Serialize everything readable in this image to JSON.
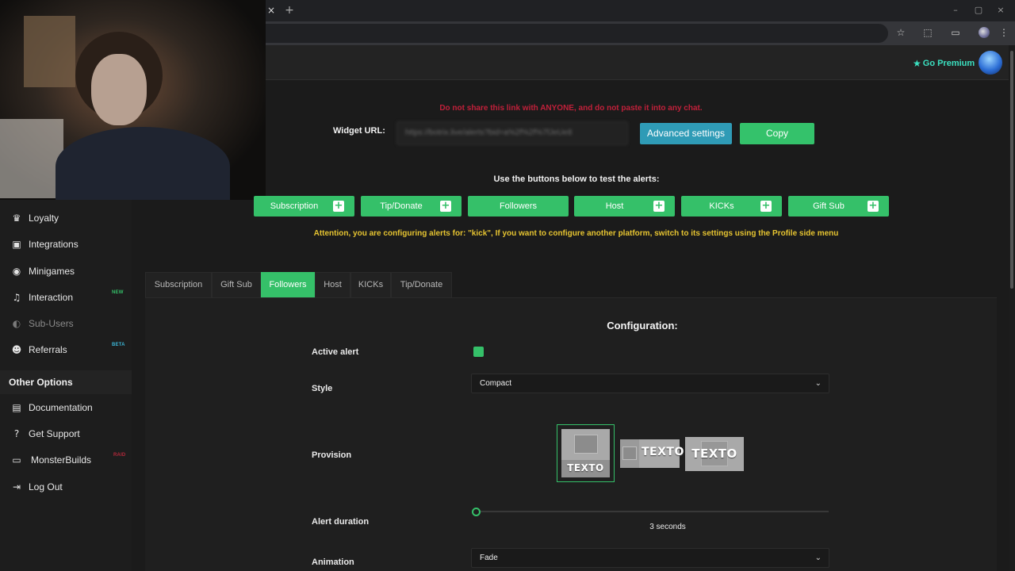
{
  "browser": {
    "tab_close": "×",
    "new_tab": "+",
    "controls": [
      "–",
      "▢",
      "×"
    ],
    "toolbar_icons": [
      "star-icon",
      "extensions-icon",
      "cast-icon",
      "profile-icon",
      "menu-icon"
    ]
  },
  "header": {
    "premium_label": "Go Premium",
    "premium_icon": "star-icon"
  },
  "widget": {
    "warning": "Do not share this link with ANYONE, and do not paste it into any chat.",
    "url_label": "Widget URL:",
    "url_value": "https://botrix.live/alerts?bid=a%2f%2f%7fJeUe8",
    "advanced_button": "Advanced settings",
    "copy_button": "Copy"
  },
  "test": {
    "title": "Use the buttons below to test the alerts:",
    "buttons": [
      {
        "label": "Subscription",
        "plus": "+"
      },
      {
        "label": "Tip/Donate",
        "plus": "+"
      },
      {
        "label": "Followers",
        "plus": ""
      },
      {
        "label": "Host",
        "plus": "+"
      },
      {
        "label": "KICKs",
        "plus": "+"
      },
      {
        "label": "Gift Sub",
        "plus": "+"
      }
    ],
    "attention": "Attention, you are configuring alerts for: \"kick\", If you want to configure another platform, switch to its settings using the Profile side menu"
  },
  "sidebar": {
    "items": [
      {
        "label": "Loyalty",
        "icon": "trophy-icon",
        "badge": ""
      },
      {
        "label": "Integrations",
        "icon": "integrations-icon",
        "badge": ""
      },
      {
        "label": "Minigames",
        "icon": "gamepad-icon",
        "badge": ""
      },
      {
        "label": "Interaction",
        "icon": "music-icon",
        "badge": "NEW"
      },
      {
        "label": "Sub-Users",
        "icon": "users-icon",
        "badge": ""
      },
      {
        "label": "Referrals",
        "icon": "referrals-icon",
        "badge": "BETA"
      }
    ],
    "section_title": "Other Options",
    "other_items": [
      {
        "label": "Documentation",
        "icon": "book-icon",
        "badge": ""
      },
      {
        "label": "Get Support",
        "icon": "question-icon",
        "badge": ""
      },
      {
        "label": "MonsterBuilds",
        "icon": "laptop-icon",
        "badge": "RAID"
      },
      {
        "label": "Log Out",
        "icon": "logout-icon",
        "badge": ""
      }
    ]
  },
  "tabs": [
    {
      "label": "Subscription",
      "active": false
    },
    {
      "label": "Gift Sub",
      "active": false
    },
    {
      "label": "Followers",
      "active": true
    },
    {
      "label": "Host",
      "active": false
    },
    {
      "label": "KICKs",
      "active": false
    },
    {
      "label": "Tip/Donate",
      "active": false
    }
  ],
  "config": {
    "title": "Configuration:",
    "active_alert_label": "Active alert",
    "active_alert_checked": true,
    "style_label": "Style",
    "style_value": "Compact",
    "provision_label": "Provision",
    "provision_option_text": "TEXTO",
    "alert_duration_label": "Alert duration",
    "alert_duration_value": "3",
    "alert_duration_unit": "seconds",
    "animation_label": "Animation",
    "animation_value": "Fade"
  },
  "colors": {
    "accent_green": "#35c069",
    "accent_teal": "#2f9bb6",
    "warning_red": "#c0203a",
    "attention_yellow": "#e6c431",
    "premium_cyan": "#3be0c0"
  }
}
